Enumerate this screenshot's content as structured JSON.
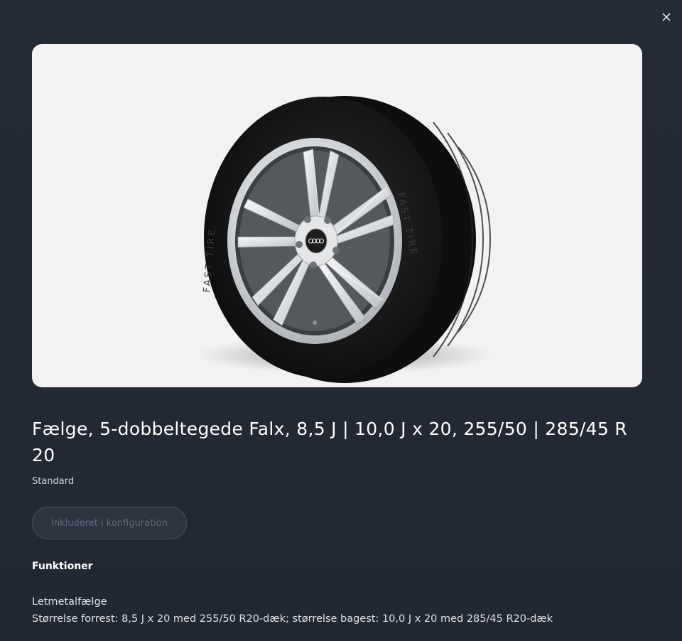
{
  "dialog": {
    "close_label": "×"
  },
  "product": {
    "image_alt": "Audi",
    "title": "Fælge, 5-dobbeltegede Falx, 8,5 J | 10,0 J x 20, 255/50 | 285/45 R 20",
    "status": "Standard",
    "cta_label": "Inkluderet i konfiguration"
  },
  "tire_text": "FAST TIRE",
  "features": {
    "heading": "Funktioner",
    "items": [
      "Letmetalfælge",
      "Størrelse forrest: 8,5 J x 20 med 255/50 R20-dæk; størrelse bagest: 10,0 J x 20 med 285/45 R20-dæk"
    ]
  },
  "colors": {
    "background": "#232a36",
    "card": "#f2f2f2",
    "tire": "#141414",
    "rim": "#d9dcdf"
  }
}
